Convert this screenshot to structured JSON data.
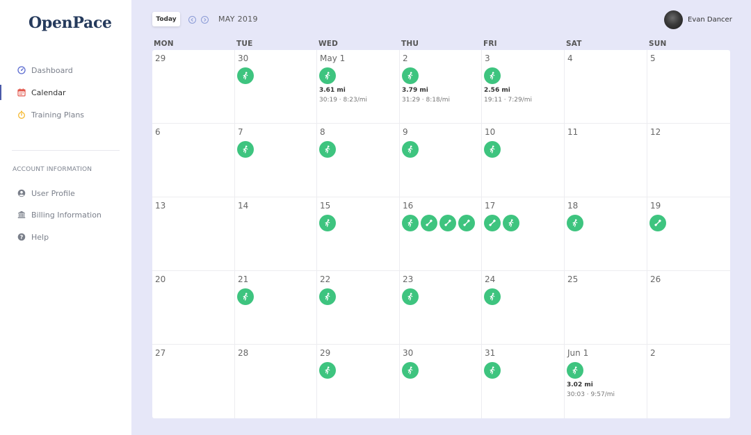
{
  "app": {
    "brand": "OpenPace"
  },
  "sidebar": {
    "nav": [
      {
        "label": "Dashboard",
        "icon": "dashboard-icon",
        "color": "#5b6bd0"
      },
      {
        "label": "Calendar",
        "icon": "calendar-icon",
        "color": "#e2574c"
      },
      {
        "label": "Training Plans",
        "icon": "stopwatch-icon",
        "color": "#f5b82e"
      }
    ],
    "section_title": "ACCOUNT INFORMATION",
    "account": [
      {
        "label": "User Profile",
        "icon": "user-icon"
      },
      {
        "label": "Billing Information",
        "icon": "bank-icon"
      },
      {
        "label": "Help",
        "icon": "help-icon"
      }
    ],
    "active_item": "Calendar"
  },
  "header": {
    "today_label": "Today",
    "month": "MAY 2019",
    "user_name": "Evan Dancer"
  },
  "calendar": {
    "weekdays": [
      "MON",
      "TUE",
      "WED",
      "THU",
      "FRI",
      "SAT",
      "SUN"
    ],
    "weeks": [
      [
        {
          "day": "29",
          "activities": []
        },
        {
          "day": "30",
          "activities": [
            "run"
          ]
        },
        {
          "day": "May 1",
          "activities": [
            "run"
          ],
          "distance": "3.61 mi",
          "pace": "30:19 · 8:23/mi"
        },
        {
          "day": "2",
          "activities": [
            "run"
          ],
          "distance": "3.79 mi",
          "pace": "31:29 · 8:18/mi"
        },
        {
          "day": "3",
          "activities": [
            "run"
          ],
          "distance": "2.56 mi",
          "pace": "19:11 · 7:29/mi"
        },
        {
          "day": "4",
          "activities": []
        },
        {
          "day": "5",
          "activities": []
        }
      ],
      [
        {
          "day": "6",
          "activities": []
        },
        {
          "day": "7",
          "activities": [
            "run"
          ]
        },
        {
          "day": "8",
          "activities": [
            "run"
          ]
        },
        {
          "day": "9",
          "activities": [
            "run"
          ]
        },
        {
          "day": "10",
          "activities": [
            "run"
          ]
        },
        {
          "day": "11",
          "activities": []
        },
        {
          "day": "12",
          "activities": []
        }
      ],
      [
        {
          "day": "13",
          "activities": []
        },
        {
          "day": "14",
          "activities": []
        },
        {
          "day": "15",
          "activities": [
            "run"
          ]
        },
        {
          "day": "16",
          "activities": [
            "run",
            "strength",
            "strength",
            "strength"
          ]
        },
        {
          "day": "17",
          "activities": [
            "strength",
            "run"
          ]
        },
        {
          "day": "18",
          "activities": [
            "run"
          ]
        },
        {
          "day": "19",
          "activities": [
            "strength"
          ]
        }
      ],
      [
        {
          "day": "20",
          "activities": []
        },
        {
          "day": "21",
          "activities": [
            "run"
          ]
        },
        {
          "day": "22",
          "activities": [
            "run"
          ]
        },
        {
          "day": "23",
          "activities": [
            "run"
          ]
        },
        {
          "day": "24",
          "activities": [
            "run"
          ]
        },
        {
          "day": "25",
          "activities": []
        },
        {
          "day": "26",
          "activities": []
        }
      ],
      [
        {
          "day": "27",
          "activities": []
        },
        {
          "day": "28",
          "activities": []
        },
        {
          "day": "29",
          "activities": [
            "run"
          ]
        },
        {
          "day": "30",
          "activities": [
            "run"
          ]
        },
        {
          "day": "31",
          "activities": [
            "run"
          ]
        },
        {
          "day": "Jun 1",
          "activities": [
            "run"
          ],
          "distance": "3.02 mi",
          "pace": "30:03 · 9:57/mi"
        },
        {
          "day": "2",
          "activities": []
        }
      ]
    ]
  },
  "colors": {
    "accent": "#3ec47f",
    "background": "#e6e7f8",
    "brand": "#253a5c"
  }
}
